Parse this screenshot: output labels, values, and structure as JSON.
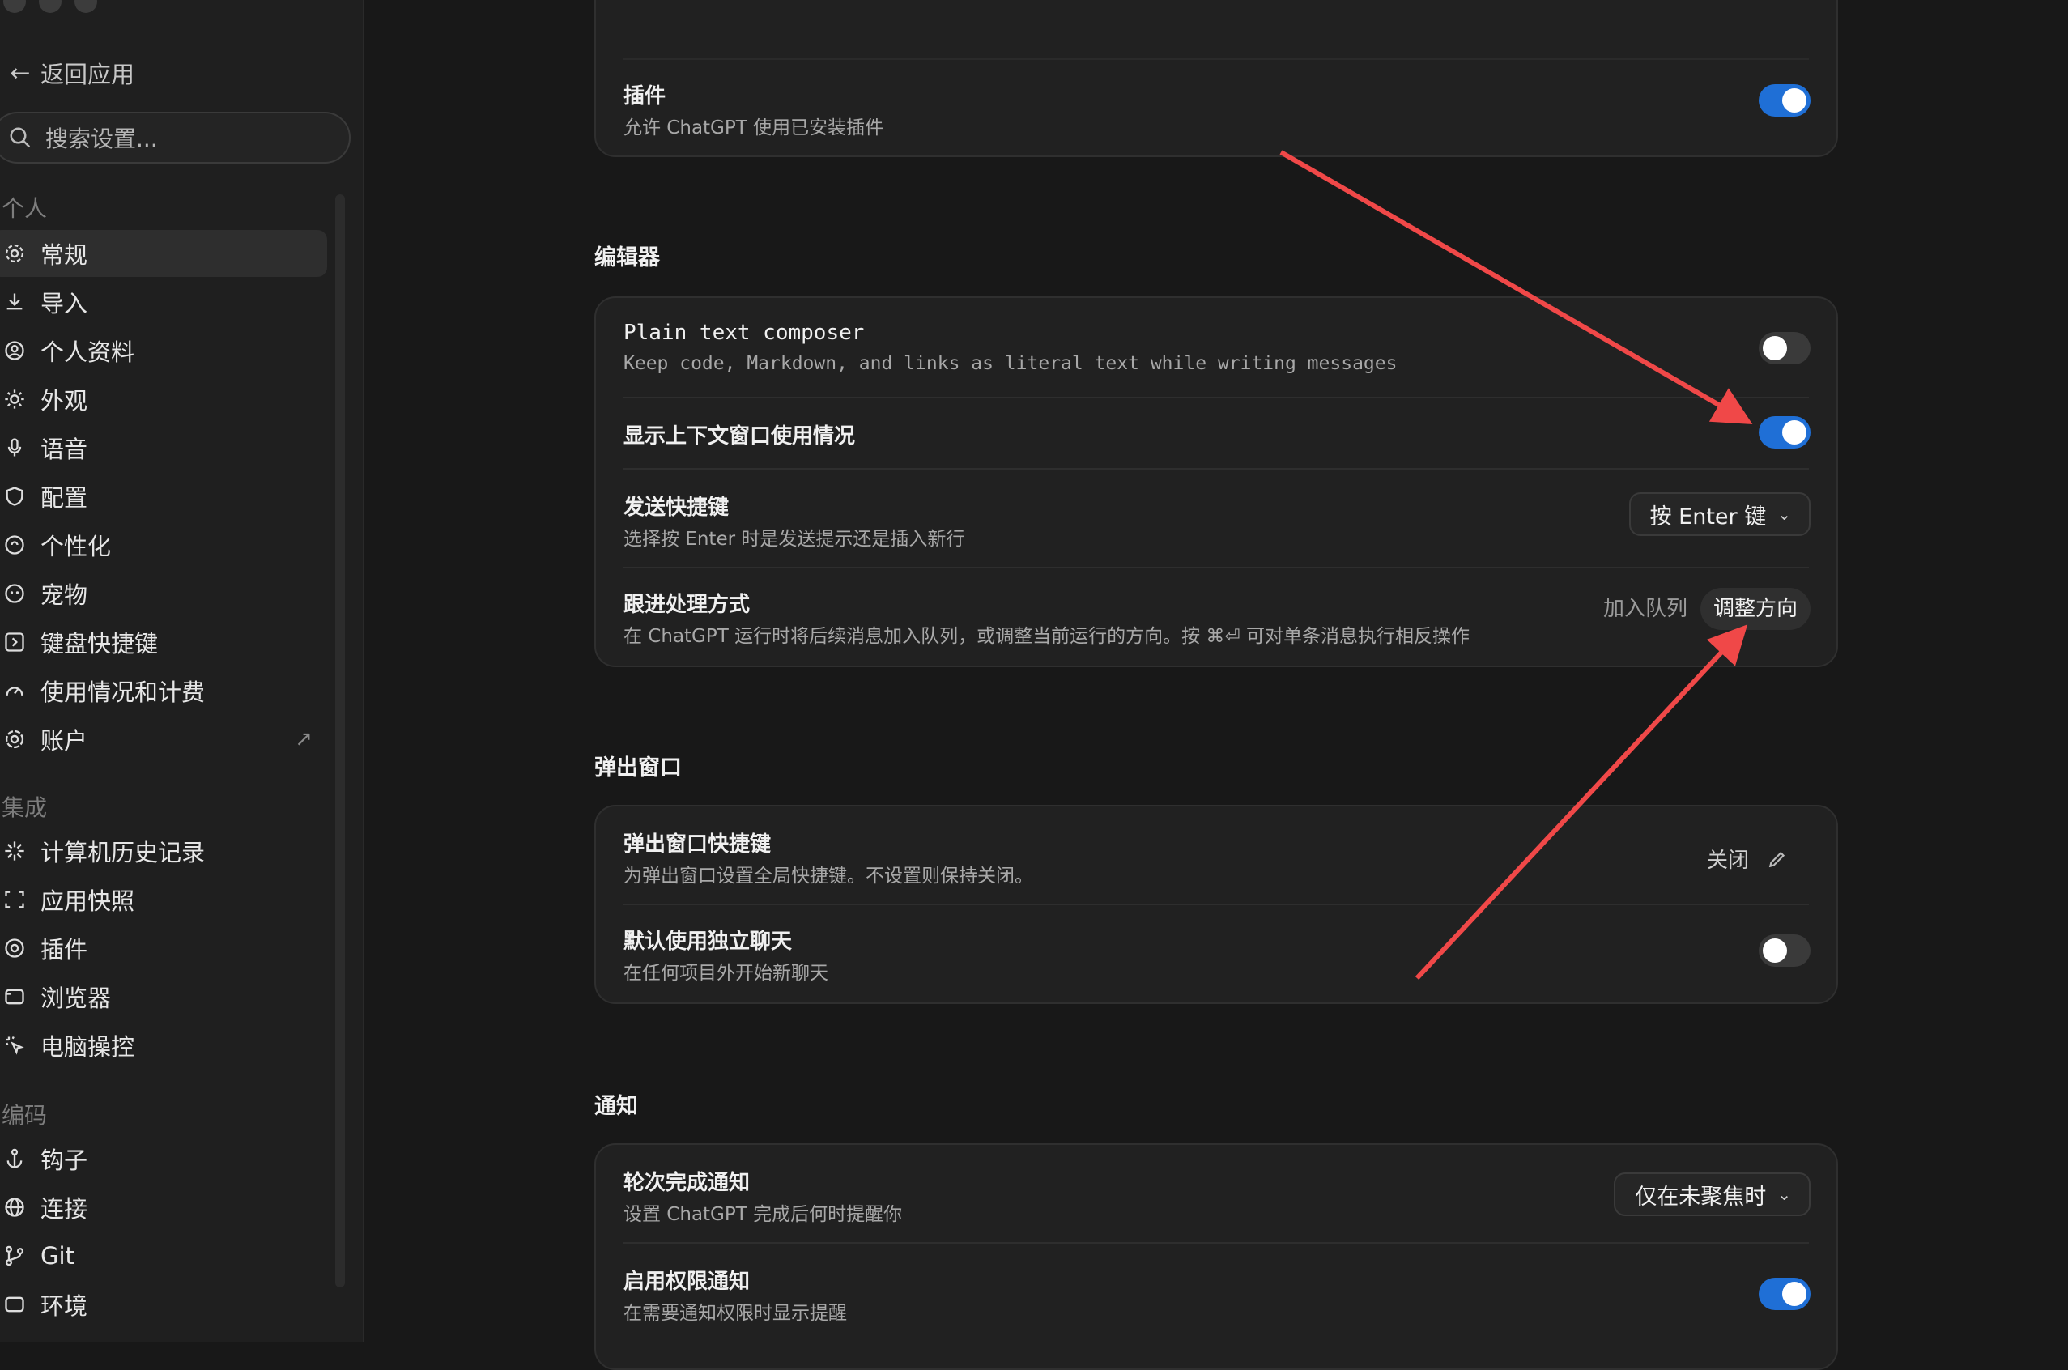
{
  "sidebar": {
    "back_label": "返回应用",
    "search_placeholder": "搜索设置...",
    "sections": {
      "personal": "个人",
      "integrations": "集成",
      "coding": "编码"
    },
    "items": [
      {
        "label": "常规",
        "icon": "gear-icon"
      },
      {
        "label": "导入",
        "icon": "download-icon"
      },
      {
        "label": "个人资料",
        "icon": "profile-icon"
      },
      {
        "label": "外观",
        "icon": "sun-icon"
      },
      {
        "label": "语音",
        "icon": "mic-icon"
      },
      {
        "label": "配置",
        "icon": "shield-icon"
      },
      {
        "label": "个性化",
        "icon": "personalize-icon"
      },
      {
        "label": "宠物",
        "icon": "pet-icon"
      },
      {
        "label": "键盘快捷键",
        "icon": "keyboard-icon"
      },
      {
        "label": "使用情况和计费",
        "icon": "gauge-icon"
      },
      {
        "label": "账户",
        "icon": "openai-icon",
        "external": "↗"
      },
      {
        "label": "计算机历史记录",
        "icon": "sparkle-icon"
      },
      {
        "label": "应用快照",
        "icon": "snapshot-icon"
      },
      {
        "label": "插件",
        "icon": "plugin-icon"
      },
      {
        "label": "浏览器",
        "icon": "browser-icon"
      },
      {
        "label": "电脑操控",
        "icon": "cursor-click-icon"
      },
      {
        "label": "钩子",
        "icon": "anchor-icon"
      },
      {
        "label": "连接",
        "icon": "globe-icon"
      },
      {
        "label": "Git",
        "icon": "git-branch-icon"
      },
      {
        "label": "环境",
        "icon": "environment-icon"
      }
    ]
  },
  "plugins_card": {
    "title": "插件",
    "desc": "允许 ChatGPT 使用已安装插件",
    "enabled": true
  },
  "editor": {
    "heading": "编辑器",
    "plain_text": {
      "title": "Plain text composer",
      "desc": "Keep code, Markdown, and links as literal text while writing messages",
      "enabled": false
    },
    "context_usage": {
      "title": "显示上下文窗口使用情况",
      "enabled": true
    },
    "send_shortcut": {
      "title": "发送快捷键",
      "desc": "选择按 Enter 时是发送提示还是插入新行",
      "value": "按 Enter 键"
    },
    "followup": {
      "title": "跟进处理方式",
      "desc": "在 ChatGPT 运行时将后续消息加入队列，或调整当前运行的方向。按 ⌘⏎ 可对单条消息执行相反操作",
      "options": [
        "加入队列",
        "调整方向"
      ],
      "selected": "调整方向"
    }
  },
  "popup": {
    "heading": "弹出窗口",
    "shortcut": {
      "title": "弹出窗口快捷键",
      "desc": "为弹出窗口设置全局快捷键。不设置则保持关闭。",
      "value": "关闭"
    },
    "standalone": {
      "title": "默认使用独立聊天",
      "desc": "在任何项目外开始新聊天",
      "enabled": false
    }
  },
  "notifications": {
    "heading": "通知",
    "turn_complete": {
      "title": "轮次完成通知",
      "desc": "设置 ChatGPT 完成后何时提醒你",
      "value": "仅在未聚焦时"
    },
    "permission": {
      "title": "启用权限通知",
      "desc": "在需要通知权限时显示提醒",
      "enabled": true
    }
  },
  "colors": {
    "accent": "#1f6fd6",
    "annotation_arrow": "#f04848"
  }
}
